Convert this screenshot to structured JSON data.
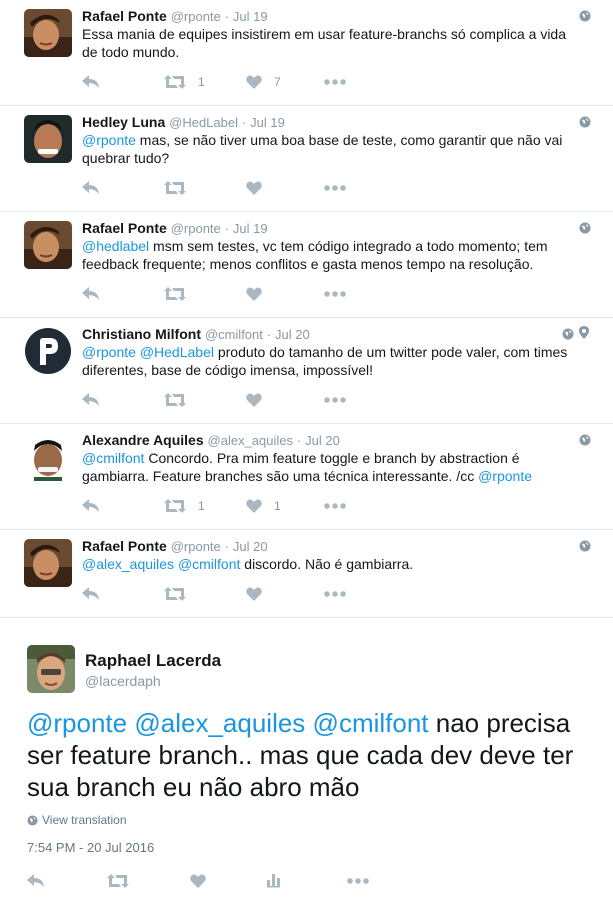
{
  "thread": [
    {
      "name": "Rafael Ponte",
      "handle": "@rponte",
      "sep": "·",
      "date": "Jul 19",
      "text_parts": [
        {
          "t": "Essa mania de equipes insistirem em usar feature-branchs só complica a vida de todo mundo.",
          "m": false
        }
      ],
      "retweets": "1",
      "likes": "7",
      "avatar": "rafael"
    },
    {
      "name": "Hedley Luna",
      "handle": "@HedLabel",
      "sep": "·",
      "date": "Jul 19",
      "text_parts": [
        {
          "t": "@rponte",
          "m": true
        },
        {
          "t": " mas, se não tiver uma boa base de teste, como garantir que não vai quebrar tudo?",
          "m": false
        }
      ],
      "retweets": "",
      "likes": "",
      "avatar": "hedley"
    },
    {
      "name": "Rafael Ponte",
      "handle": "@rponte",
      "sep": "·",
      "date": "Jul 19",
      "text_parts": [
        {
          "t": "@hedlabel",
          "m": true
        },
        {
          "t": " msm sem testes, vc tem código integrado a todo momento; tem feedback frequente; menos conflitos e gasta menos tempo na resolução.",
          "m": false
        }
      ],
      "retweets": "",
      "likes": "",
      "avatar": "rafael"
    },
    {
      "name": "Christiano Milfont",
      "handle": "@cmilfont",
      "sep": "·",
      "date": "Jul 20",
      "text_parts": [
        {
          "t": "@rponte",
          "m": true
        },
        {
          "t": " ",
          "m": false
        },
        {
          "t": "@HedLabel",
          "m": true
        },
        {
          "t": " produto do tamanho de um twitter pode valer, com times diferentes, base de código imensa, impossível!",
          "m": false
        }
      ],
      "retweets": "",
      "likes": "",
      "avatar": "christiano"
    },
    {
      "name": "Alexandre Aquiles",
      "handle": "@alex_aquiles",
      "sep": "·",
      "date": "Jul 20",
      "text_parts": [
        {
          "t": "@cmilfont",
          "m": true
        },
        {
          "t": " Concordo. Pra mim feature toggle e branch by abstraction é gambiarra. Feature branches são uma técnica interessante. /cc ",
          "m": false
        },
        {
          "t": "@rponte",
          "m": true
        }
      ],
      "retweets": "1",
      "likes": "1",
      "avatar": "alexandre"
    },
    {
      "name": "Rafael Ponte",
      "handle": "@rponte",
      "sep": "·",
      "date": "Jul 20",
      "text_parts": [
        {
          "t": "@alex_aquiles",
          "m": true
        },
        {
          "t": " ",
          "m": false
        },
        {
          "t": "@cmilfont",
          "m": true
        },
        {
          "t": " discordo. Não é gambiarra.",
          "m": false
        }
      ],
      "retweets": "",
      "likes": "",
      "avatar": "rafael"
    }
  ],
  "focused": {
    "name": "Raphael Lacerda",
    "handle": "@lacerdaph",
    "text_parts": [
      {
        "t": "@rponte",
        "m": true
      },
      {
        "t": " ",
        "m": false
      },
      {
        "t": "@alex_aquiles",
        "m": true
      },
      {
        "t": " ",
        "m": false
      },
      {
        "t": "@cmilfont",
        "m": true
      },
      {
        "t": " nao precisa ser feature branch.. mas que cada dev deve ter sua branch eu não abro mão",
        "m": false
      }
    ],
    "translate": "View translation",
    "timestamp": "7:54 PM - 20 Jul 2016"
  },
  "colors": {
    "mention": "#1b95e0",
    "icon": "#aab8c2",
    "meta": "#8899a6",
    "divider": "#e1e8ed"
  },
  "icons": [
    "reply-icon",
    "retweet-icon",
    "heart-icon",
    "more-icon",
    "globe-icon",
    "location-icon",
    "analytics-icon"
  ]
}
